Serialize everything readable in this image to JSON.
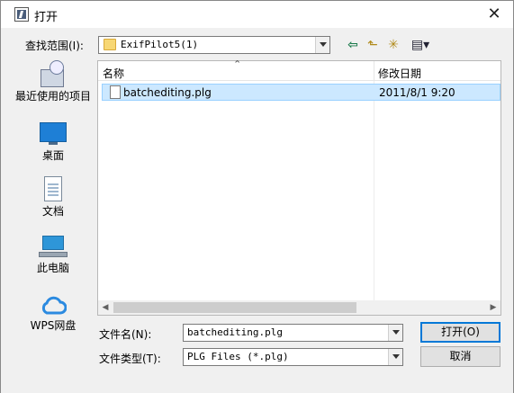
{
  "window": {
    "title": "打开"
  },
  "lookin": {
    "label": "查找范围(I):",
    "value": "ExifPilot5(1)"
  },
  "places": [
    {
      "label": "最近使用的项目",
      "icon": "recent-places-icon"
    },
    {
      "label": "桌面",
      "icon": "desktop-icon"
    },
    {
      "label": "文档",
      "icon": "documents-icon"
    },
    {
      "label": "此电脑",
      "icon": "this-pc-icon"
    },
    {
      "label": "WPS网盘",
      "icon": "wps-cloud-icon"
    }
  ],
  "filelist": {
    "columns": [
      "名称",
      "修改日期"
    ],
    "files": [
      {
        "name": "batchediting.plg",
        "date": "2011/8/1 9:20"
      }
    ]
  },
  "filename": {
    "label": "文件名(N):",
    "value": "batchediting.plg"
  },
  "filetype": {
    "label": "文件类型(T):",
    "value": "PLG Files (*.plg)"
  },
  "buttons": {
    "open": "打开(O)",
    "cancel": "取消"
  },
  "colors": {
    "selection": "#cce8ff",
    "accent": "#0078d7"
  }
}
